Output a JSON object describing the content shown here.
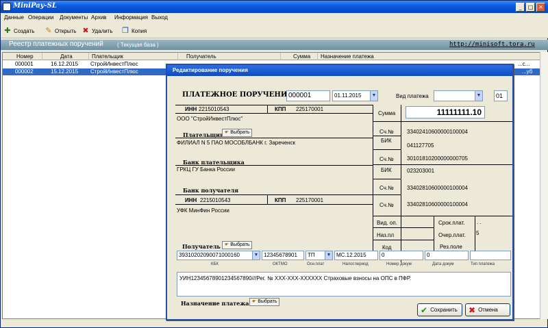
{
  "app": {
    "title": "MiniPay-SL"
  },
  "window_controls": {
    "minimize": "_",
    "maximize": "□",
    "close": "✕"
  },
  "menu": [
    "Данные",
    "Операции",
    "Документы",
    "Архив",
    "Информация",
    "Выход"
  ],
  "toolbar": {
    "create": "Создать",
    "open": "Открыть",
    "delete": "Удалить",
    "copy": "Копия"
  },
  "registry": {
    "title": "Реестр платежных поручений",
    "subtitle": "( Текущая база )",
    "link": "http://minisoft.tora.ru"
  },
  "grid": {
    "columns": [
      "Номер",
      "Дата",
      "Плательщик",
      "Получатель",
      "Сумма",
      "Назначение платежа"
    ],
    "rows": [
      {
        "number": "000001",
        "date": "16.12.2015",
        "payer": "СтройИнвестПлюс",
        "tail": "...с..."
      },
      {
        "number": "000002",
        "date": "15.12.2015",
        "payer": "СтройИнвестПлюс",
        "tail": "...уб"
      }
    ]
  },
  "dialog": {
    "title": "Редактирование поручения",
    "doc_title": "ПЛАТЕЖНОЕ ПОРУЧЕНИЕ №",
    "doc_number": "000001",
    "doc_date": "01.11.2015",
    "payment_kind_label": "Вид платежа",
    "payment_kind_value": "",
    "priority_code": "01",
    "payer": {
      "inn_label": "ИНН",
      "inn": "2215010543",
      "kpp_label": "КПП",
      "kpp": "225170001",
      "name": "ООО \"СтройИнвестПлюс\"",
      "section_label": "Плательщик",
      "bank_name": "ФИЛИАЛ N 5 ПАО МОСОБЛБАНК г. Зареченск",
      "bank_section_label": "Банк плательщика"
    },
    "recipient_bank": {
      "name": "ГРКЦ ГУ Банка России",
      "section_label": "Банк получателя"
    },
    "recipient": {
      "inn_label": "ИНН",
      "inn": "2215010543",
      "kpp_label": "КПП",
      "kpp": "225170001",
      "name": "УФК МинФин России",
      "section_label": "Получатель"
    },
    "pick_label": "Выбрать",
    "right": {
      "sum_label": "Сумма",
      "sum": "11111111.10",
      "acc_label": "Сч.№",
      "payer_account": "33402410600000100004",
      "bik_label": "БИК",
      "payer_bik": "041127705",
      "payer_corr": "30101810200000000705",
      "recipient_bik": "023203001",
      "recipient_corr": "33402810600000100004",
      "recipient_account": "33402810600000100004",
      "vid_op_label": "Вид. оп.",
      "naz_pl_label": "Наз.пл",
      "kod_label": "Код",
      "srok_label": "Срок.плат.",
      "srok_value": ". .",
      "ocher_label": "Очер.плат.",
      "ocher_value": "5",
      "rez_label": "Рез.поле"
    },
    "tax": {
      "kbk": "39310202090071000160",
      "oktmo": "12345678901",
      "basis": "ТП",
      "period": "МС.12.2015",
      "doc_num": "0",
      "doc_date": "0",
      "labels": [
        "КБК",
        "ОКТМО",
        "Осн.плат",
        "Налог.период",
        "Номер докум",
        "Дата докум",
        "Тип платежа"
      ]
    },
    "purpose_text": "УИН12345678901234567890///Рег. № XXX-XXX-XXXXXX Страховые взносы на ОПС в ПФР.",
    "purpose_label": "Назначение платежа",
    "save": "Сохранить",
    "cancel": "Отмена"
  }
}
